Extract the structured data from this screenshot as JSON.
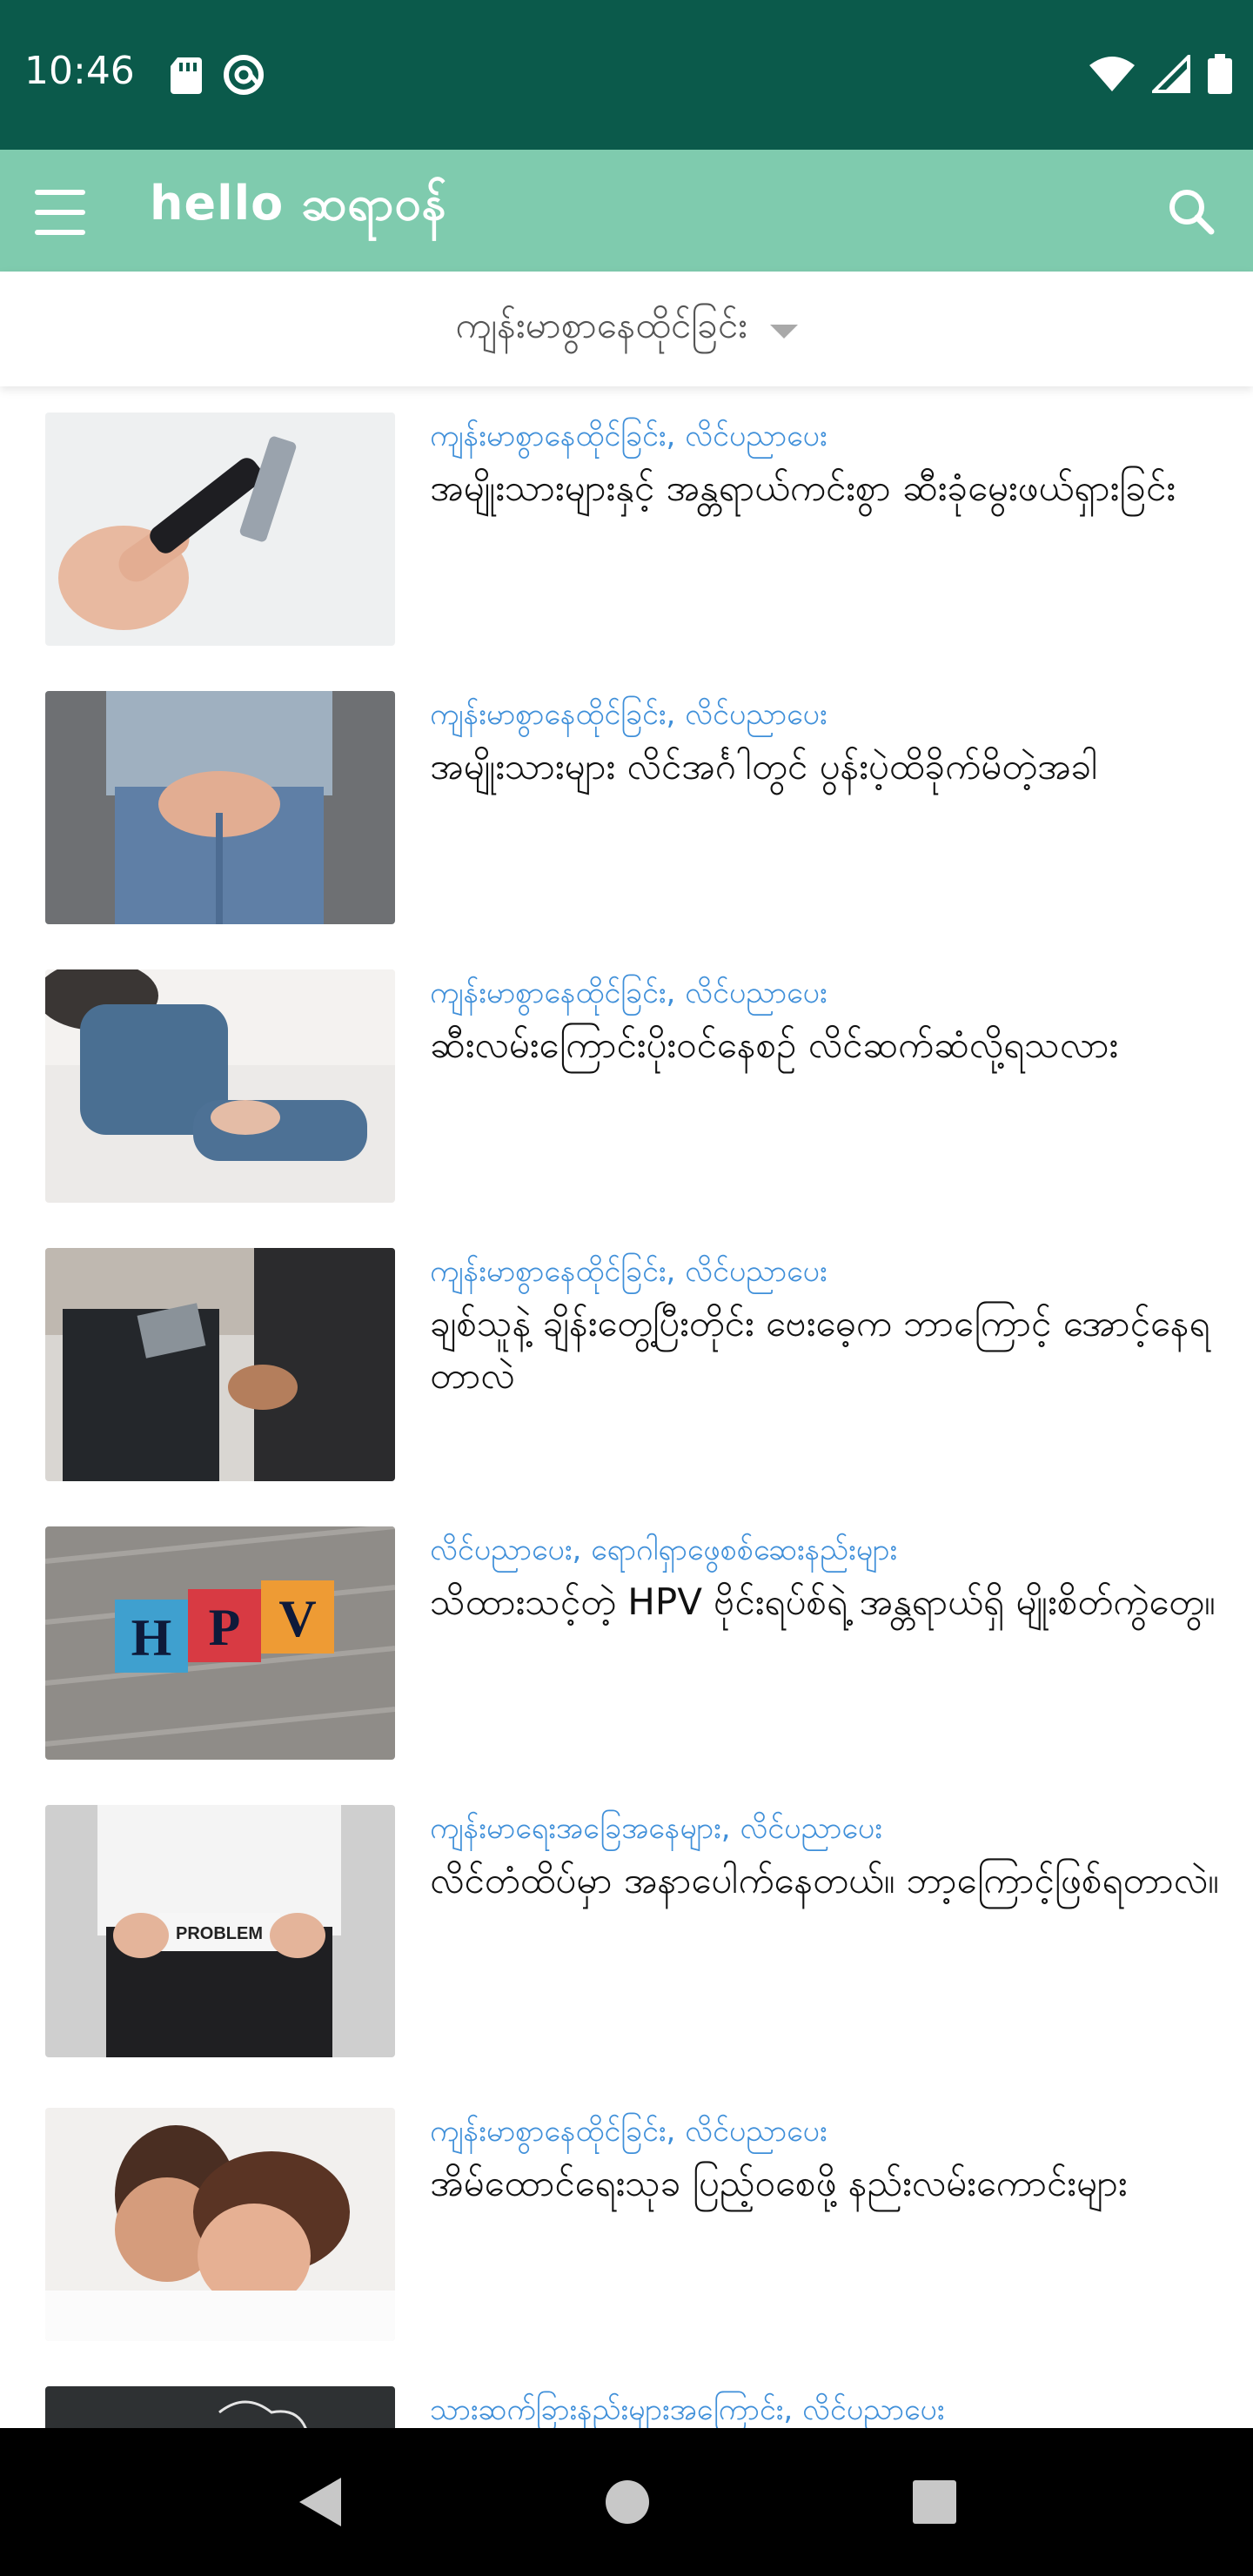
{
  "status": {
    "time": "10:46"
  },
  "app": {
    "logo_text": "hello ဆရာဝန်"
  },
  "filter": {
    "label": "ကျန်းမာစွာနေထိုင်ခြင်း"
  },
  "articles": [
    {
      "category": "ကျန်းမာစွာနေထိုင်ခြင်း, လိင်ပညာပေး",
      "title": "အမျိုးသားများနှင့် အန္တရာယ်ကင်းစွာ ဆီးခုံမွေးဖယ်ရှားခြင်း"
    },
    {
      "category": "ကျန်းမာစွာနေထိုင်ခြင်း, လိင်ပညာပေး",
      "title": "အမျိုးသားများ လိင်အင်္ဂါတွင် ပွန်းပဲ့ထိခိုက်မိတဲ့အခါ"
    },
    {
      "category": "ကျန်းမာစွာနေထိုင်ခြင်း, လိင်ပညာပေး",
      "title": "ဆီးလမ်းကြောင်းပိုးဝင်နေစဉ် လိင်ဆက်ဆံလို့ရသလား"
    },
    {
      "category": "ကျန်းမာစွာနေထိုင်ခြင်း, လိင်ပညာပေး",
      "title": "ချစ်သူနဲ့ ချိန်းတွေ့ပြီးတိုင်း ဗေးဓေ့က ဘာကြောင့် အောင့်နေရတာလဲ"
    },
    {
      "category": "လိင်ပညာပေး, ရောဂါရှာဖွေစစ်ဆေးနည်းများ",
      "title": "သိထားသင့်တဲ့ HPV ဗိုင်းရပ်စ်ရဲ့ အန္တရာယ်ရှိ မျိုးစိတ်ကွဲတွေ။"
    },
    {
      "category": "ကျန်းမာရေးအခြေအနေများ, လိင်ပညာပေး",
      "title": "လိင်တံထိပ်မှာ အနာပေါက်နေတယ်။ ဘာ့ကြောင့်ဖြစ်ရတာလဲ။"
    },
    {
      "category": "ကျန်းမာစွာနေထိုင်ခြင်း, လိင်ပညာပေး",
      "title": "အိမ်ထောင်ရေးသုခ ပြည့်ဝစေဖို့ နည်းလမ်းကောင်းများ"
    },
    {
      "category": "သားဆက်ခြားနည်းများအကြောင်း, လိင်ပညာပေး",
      "title": ""
    }
  ],
  "thumb_text": {
    "hpv_letters": [
      "H",
      "P",
      "V"
    ],
    "problem_sign": "PROBLEM"
  },
  "colors": {
    "status_bar": "#0b5a4b",
    "app_bar": "#7fcbae",
    "category": "#3f8fd9"
  },
  "icons": {
    "menu": "menu-icon",
    "search": "search-icon",
    "nav_back": "back-triangle-icon",
    "nav_home": "home-circle-icon",
    "nav_recents": "recents-square-icon"
  }
}
